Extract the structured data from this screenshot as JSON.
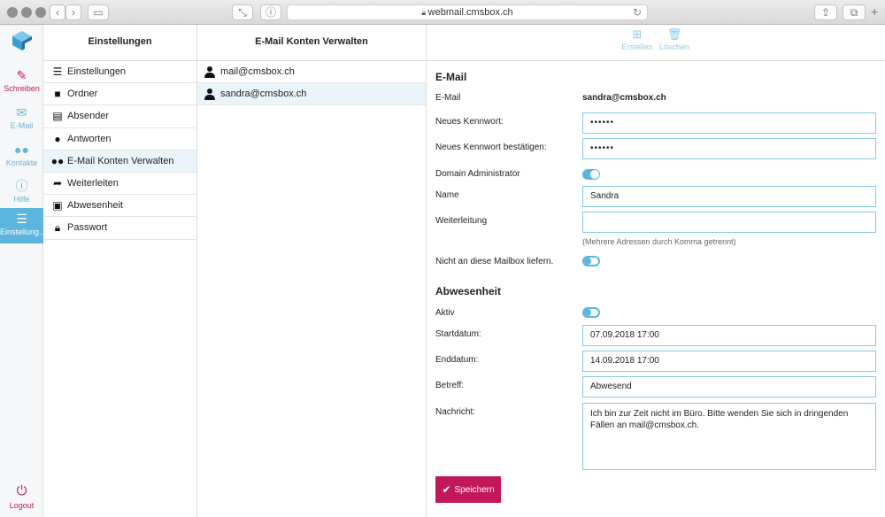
{
  "browser": {
    "url": "webmail.cmsbox.ch"
  },
  "rail": {
    "items": [
      {
        "label": "Schreiben",
        "icon": "compose-icon"
      },
      {
        "label": "E-Mail",
        "icon": "mail-icon"
      },
      {
        "label": "Kontakte",
        "icon": "contacts-icon"
      },
      {
        "label": "Hilfe",
        "icon": "info-icon"
      },
      {
        "label": "Einstellung...",
        "icon": "settings-icon"
      }
    ],
    "logout": "Logout"
  },
  "settings": {
    "title": "Einstellungen",
    "items": [
      {
        "label": "Einstellungen",
        "icon": "sliders-icon"
      },
      {
        "label": "Ordner",
        "icon": "folder-icon"
      },
      {
        "label": "Absender",
        "icon": "id-card-icon"
      },
      {
        "label": "Antworten",
        "icon": "speech-bubble-icon"
      },
      {
        "label": "E-Mail Konten Verwalten",
        "icon": "users-icon"
      },
      {
        "label": "Weiterleiten",
        "icon": "forward-arrow-icon"
      },
      {
        "label": "Abwesenheit",
        "icon": "calendar-x-icon"
      },
      {
        "label": "Passwort",
        "icon": "lock-icon"
      }
    ],
    "active_index": 4
  },
  "accounts": {
    "title": "E-Mail Konten Verwalten",
    "items": [
      "mail@cmsbox.ch",
      "sandra@cmsbox.ch"
    ],
    "active_index": 1
  },
  "toolbar": {
    "create": "Erstellen",
    "delete": "Löschen"
  },
  "form": {
    "email_section": "E-Mail",
    "email_label": "E-Mail",
    "email_value": "sandra@cmsbox.ch",
    "new_pw_label": "Neues Kennwort:",
    "new_pw_value": "••••••",
    "confirm_pw_label": "Neues Kennwort bestätigen:",
    "confirm_pw_value": "••••••",
    "domain_admin_label": "Domain Administrator",
    "domain_admin_on": true,
    "name_label": "Name",
    "name_value": "Sandra",
    "forward_label": "Weiterleitung",
    "forward_value": "",
    "forward_hint": "(Mehrere Adressen durch Komma getrennt)",
    "no_deliver_label": "Nicht an diese Mailbox liefern.",
    "no_deliver_on": false,
    "absence_section": "Abwesenheit",
    "active_label": "Aktiv",
    "active_on": false,
    "start_label": "Startdatum:",
    "start_value": "07.09.2018 17:00",
    "end_label": "Enddatum:",
    "end_value": "14.09.2018 17:00",
    "subject_label": "Betreff:",
    "subject_value": "Abwesend",
    "message_label": "Nachricht:",
    "message_value": "Ich bin zur Zeit nicht im Büro. Bitte wenden Sie sich in dringenden Fällen an mail@cmsbox.ch.",
    "save_label": "Speichern"
  },
  "colors": {
    "accent": "#5cb5dc",
    "brand": "#c2185b",
    "selected_row": "#eaf5fb"
  }
}
